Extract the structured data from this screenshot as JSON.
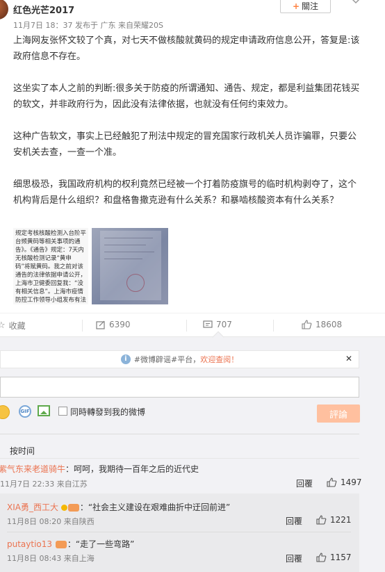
{
  "post": {
    "username": "红色光芒2017",
    "meta": "11月7日 18：37 发布于 广东 来自荣耀20S",
    "follow_label": "關注",
    "paragraphs": [
      "上海网友张怀文较了个真，对七天不做核酸就黄码的规定申请政府信息公开，答复是:该政府信息不存在。",
      "这坐实了本人之前的判断:很多关于防疫的所谓通知、通告、规定，都是利益集团花钱买的软文，并非政府行为，因此没有法律依据，也就没有任何约束效力。",
      "这种广告软文，事实上已经触犯了刑法中规定的冒充国家行政机关人员诈骗罪，只要公安机关去查，一查一个准。",
      "细思极恐，我国政府机构的权利竟然已经被一个打着防疫旗号的临时机构剥夺了，这个机构背后是什么组织？和盘格鲁撒克逊有什么关系？和暴啮核酸资本有什么关系？"
    ],
    "image1_text": "规定考核核酸检测入台阶平台频黄码等相关事项的通告》。《通告》规定：7天内无核酸检测记录“黄申码”将赋黄码。我之前对该通告的法律依据申请公开，上海市卫健委回复我：“没有相关信息”。上海市疫情防控工作领导小组发布有法律依据的通告是非"
  },
  "actions": {
    "favorite_label": "收藏",
    "repost_count": "6390",
    "comment_count": "707",
    "like_count": "18608"
  },
  "comment_box": {
    "notice_prefix": "#微博辟谣#平台，",
    "notice_link": "欢迎查阅！",
    "close": "✕",
    "input_value": "",
    "repost_label": "同時轉發到我的微博",
    "submit_label": "評論"
  },
  "sort": {
    "label": "按时间"
  },
  "comments": [
    {
      "name": "紫气东来老道骑牛",
      "text": "：呵呵，我期待一百年之后的近代史",
      "time": "11月7日 22:33 来自江苏",
      "reply": "回覆",
      "likes": "1497"
    }
  ],
  "replies": [
    {
      "name": "XIA勇_西工大",
      "text": "：“社会主义建设在艰难曲折中迂回前进”",
      "time": "11月8日 08:20 来自陕西",
      "reply": "回覆",
      "likes": "1221"
    },
    {
      "name": "putaytio13",
      "text": "：“走了一些弯路”",
      "time": "11月8日 08:43 来自上海",
      "reply": "回覆",
      "likes": "1157"
    }
  ],
  "colors": {
    "accent": "#eb7350",
    "submit_disabled": "#ffc09f",
    "panel_bg": "#f2f2f5"
  }
}
